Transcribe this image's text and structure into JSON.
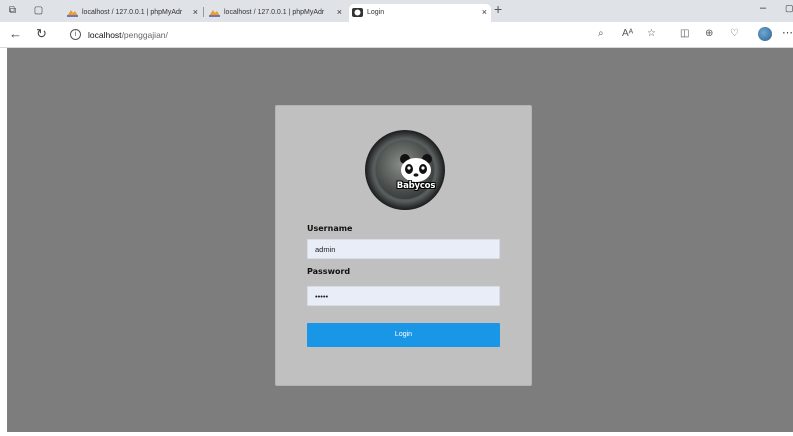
{
  "browser": {
    "tabs": [
      {
        "title": "localhost / 127.0.0.1 | phpMyAdr",
        "active": false,
        "favicon": "phpmyadmin-icon"
      },
      {
        "title": "localhost / 127.0.0.1 | phpMyAdr",
        "active": false,
        "favicon": "phpmyadmin-icon"
      },
      {
        "title": "Login",
        "active": true,
        "favicon": "panda-icon"
      }
    ],
    "tab_close_glyph": "×",
    "new_tab_glyph": "+",
    "url_host": "localhost",
    "url_path": "/penggajian/",
    "colors": {
      "tabbar": "#dfe3e8",
      "active_tab": "#ffffff"
    }
  },
  "page": {
    "background": "#7d7d7d",
    "card_background": "#c0c0c0",
    "logo": {
      "brand_text": "Babycos"
    },
    "form": {
      "username_label": "Username",
      "username_value": "admin",
      "password_label": "Password",
      "password_value": "admin",
      "login_button_label": "Login",
      "button_color": "#1a96e6"
    }
  }
}
